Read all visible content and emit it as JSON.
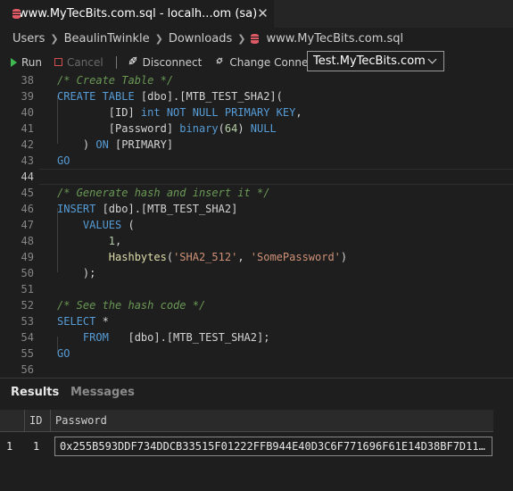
{
  "tab": {
    "title": "www.MyTecBits.com.sql - localh...om (sa)",
    "close": "✕"
  },
  "breadcrumb": [
    "Users",
    "BeaulinTwinkle",
    "Downloads",
    "www.MyTecBits.com.sql"
  ],
  "toolbar": {
    "run": "Run",
    "cancel": "Cancel",
    "disconnect": "Disconnect",
    "change_connection": "Change Connection",
    "connection": "Test.MyTecBits.com"
  },
  "editor": {
    "line_numbers": [
      "38",
      "39",
      "40",
      "41",
      "42",
      "43",
      "44",
      "45",
      "46",
      "47",
      "48",
      "49",
      "50",
      "51",
      "52",
      "53",
      "54",
      "55",
      "56"
    ],
    "current_line": "44",
    "lines": [
      [
        [
          "com",
          "/* Create Table */"
        ]
      ],
      [
        [
          "kw",
          "CREATE TABLE "
        ],
        [
          "pl",
          "[dbo].[MTB_TEST_SHA2]("
        ]
      ],
      [
        [
          "pl",
          "        [ID] "
        ],
        [
          "kw",
          "int NOT NULL PRIMARY KEY"
        ],
        [
          "pl",
          ","
        ]
      ],
      [
        [
          "pl",
          "        [Password] "
        ],
        [
          "kw",
          "binary"
        ],
        [
          "pl",
          "("
        ],
        [
          "num",
          "64"
        ],
        [
          "pl",
          ") "
        ],
        [
          "kw",
          "NULL"
        ]
      ],
      [
        [
          "pl",
          "    ) "
        ],
        [
          "kw",
          "ON "
        ],
        [
          "pl",
          "[PRIMARY]"
        ]
      ],
      [
        [
          "kw",
          "GO"
        ]
      ],
      [],
      [
        [
          "com",
          "/* Generate hash and insert it */"
        ]
      ],
      [
        [
          "kw",
          "INSERT "
        ],
        [
          "pl",
          "[dbo].[MTB_TEST_SHA2]"
        ]
      ],
      [
        [
          "pl",
          "    "
        ],
        [
          "kw",
          "VALUES "
        ],
        [
          "pl",
          "("
        ]
      ],
      [
        [
          "pl",
          "        "
        ],
        [
          "num",
          "1"
        ],
        [
          "pl",
          ","
        ]
      ],
      [
        [
          "pl",
          "        "
        ],
        [
          "fn",
          "Hashbytes"
        ],
        [
          "pl",
          "("
        ],
        [
          "str",
          "'SHA2_512'"
        ],
        [
          "pl",
          ", "
        ],
        [
          "str",
          "'SomePassword'"
        ],
        [
          "pl",
          ")"
        ]
      ],
      [
        [
          "pl",
          "    );"
        ]
      ],
      [],
      [
        [
          "com",
          "/* See the hash code */"
        ]
      ],
      [
        [
          "kw",
          "SELECT "
        ],
        [
          "pl",
          "*"
        ]
      ],
      [
        [
          "pl",
          "    "
        ],
        [
          "kw",
          "FROM   "
        ],
        [
          "pl",
          "[dbo].[MTB_TEST_SHA2];"
        ]
      ],
      [
        [
          "kw",
          "GO"
        ]
      ],
      []
    ]
  },
  "results": {
    "tabs": [
      "Results",
      "Messages"
    ],
    "columns": [
      "ID",
      "Password"
    ],
    "rows": [
      {
        "row_num": "1",
        "id": "1",
        "password": "0x255B593DDF734DDCB33515F01222FFB944E40D3C6F771696F61E14D38BF7D11…"
      }
    ]
  }
}
